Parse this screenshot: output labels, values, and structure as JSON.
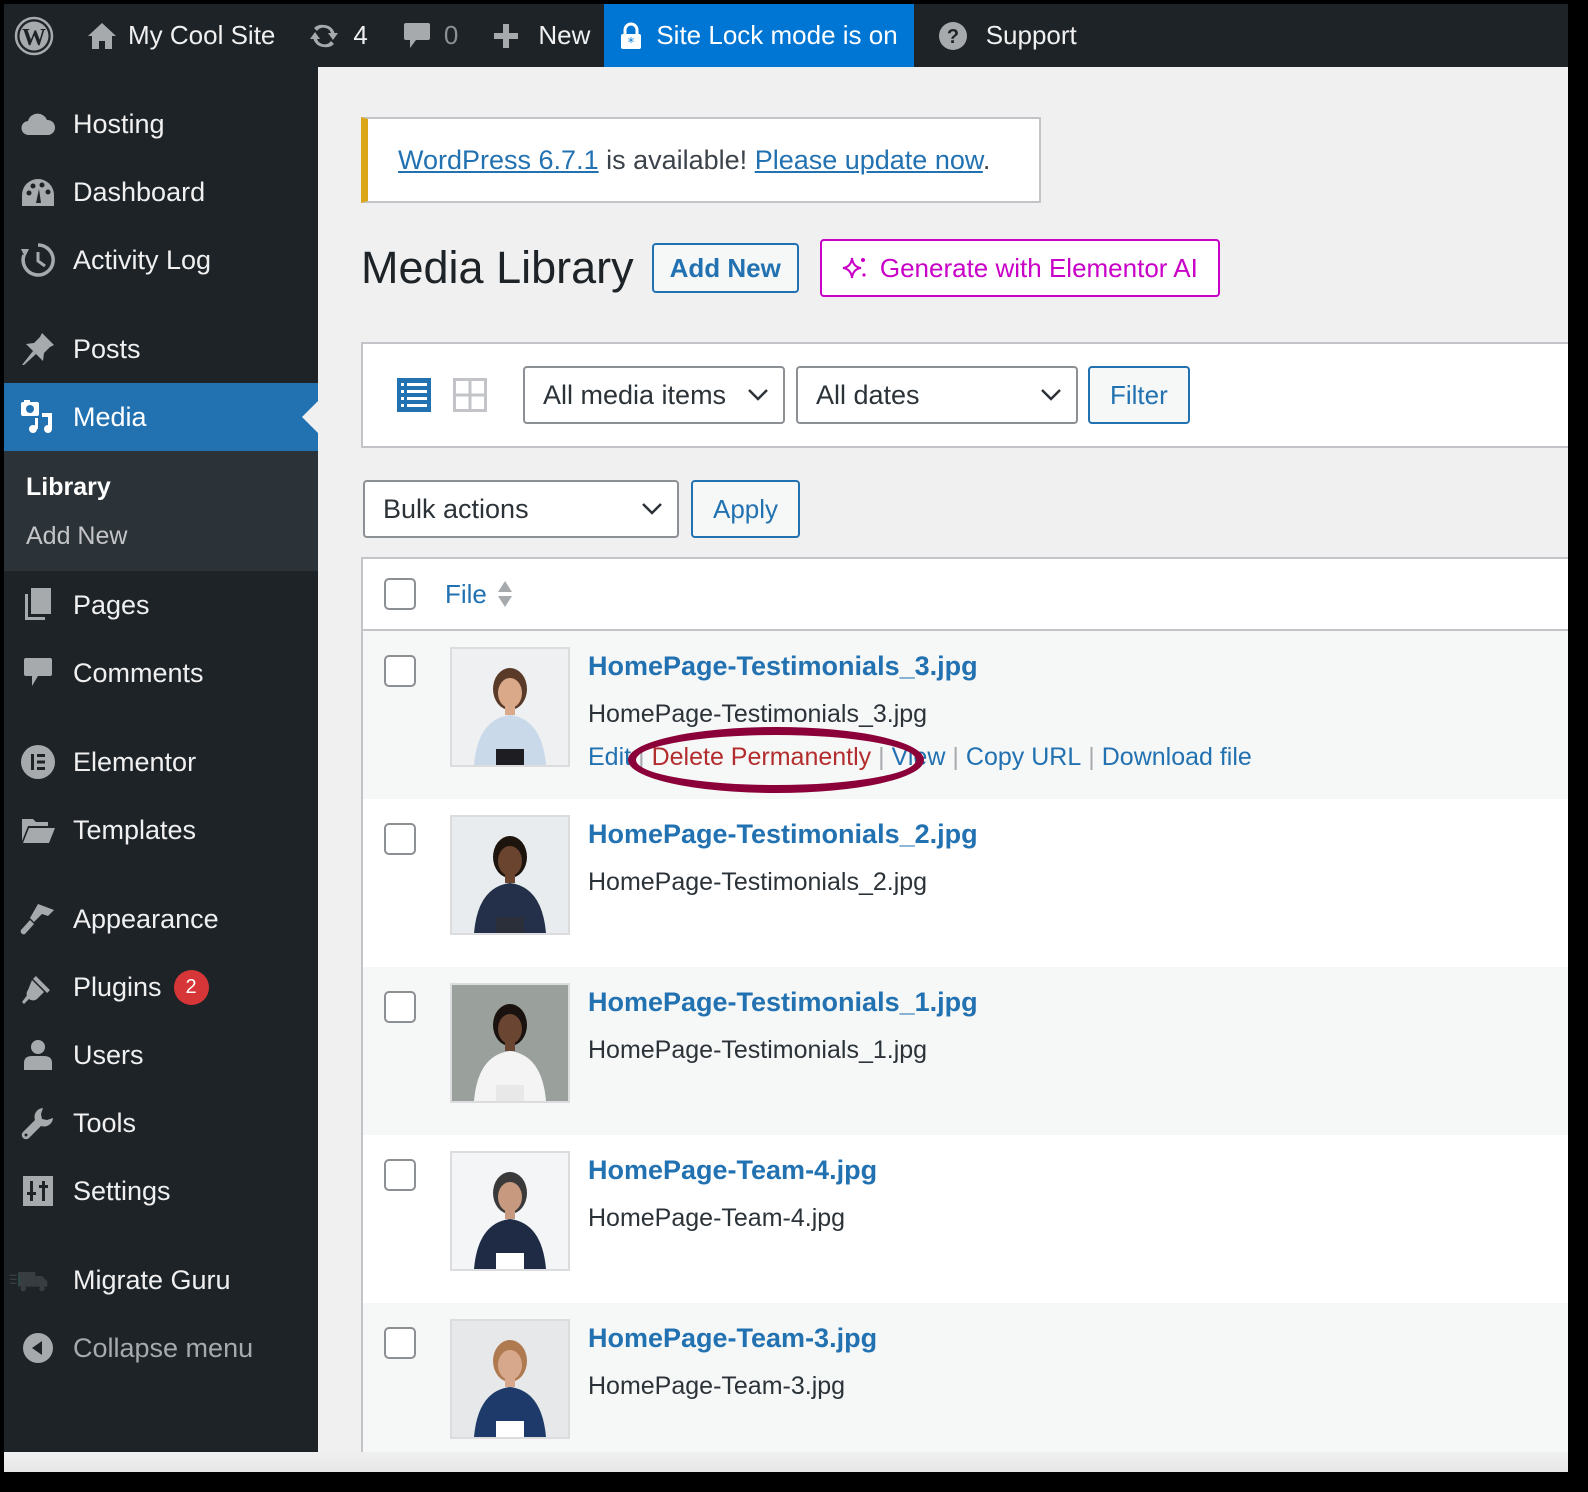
{
  "admin_bar": {
    "wp_logo": "wordpress-logo-icon",
    "site_name": "My Cool Site",
    "updates_count": "4",
    "comments_count": "0",
    "new_label": "New",
    "site_lock_label": "Site Lock mode is on",
    "support_label": "Support",
    "site_lock_color": "#0076d4"
  },
  "sidebar": {
    "items": [
      {
        "label": "Hosting",
        "icon": "cloud-icon"
      },
      {
        "label": "Dashboard",
        "icon": "dashboard-icon"
      },
      {
        "label": "Activity Log",
        "icon": "history-icon"
      },
      {
        "label": "Posts",
        "icon": "pin-icon"
      },
      {
        "label": "Media",
        "icon": "media-icon",
        "active": true
      },
      {
        "label": "Pages",
        "icon": "pages-icon"
      },
      {
        "label": "Comments",
        "icon": "comment-icon"
      },
      {
        "label": "Elementor",
        "icon": "elementor-icon"
      },
      {
        "label": "Templates",
        "icon": "folder-icon"
      },
      {
        "label": "Appearance",
        "icon": "paintbrush-icon"
      },
      {
        "label": "Plugins",
        "icon": "plugin-icon",
        "badge": "2"
      },
      {
        "label": "Users",
        "icon": "user-icon"
      },
      {
        "label": "Tools",
        "icon": "wrench-icon"
      },
      {
        "label": "Settings",
        "icon": "settings-icon"
      },
      {
        "label": "Migrate Guru",
        "icon": "truck-icon"
      },
      {
        "label": "Collapse menu",
        "icon": "collapse-icon"
      }
    ],
    "submenu": [
      {
        "label": "Library",
        "current": true
      },
      {
        "label": "Add New"
      }
    ],
    "active_color": "#2271b1"
  },
  "notice": {
    "link1": "WordPress 6.7.1",
    "text": " is available! ",
    "link2": "Please update now",
    "suffix": "."
  },
  "page": {
    "title": "Media Library",
    "add_new_label": "Add New",
    "ai_label": "Generate with Elementor AI",
    "ai_color": "#c800c8"
  },
  "filters": {
    "view_list": "list-view-icon",
    "view_grid": "grid-view-icon",
    "media_type_selected": "All media items",
    "date_selected": "All dates",
    "filter_label": "Filter"
  },
  "bulk": {
    "selected": "Bulk actions",
    "apply_label": "Apply"
  },
  "table": {
    "column_file": "File",
    "rows": [
      {
        "title": "HomePage-Testimonials_3.jpg",
        "filename": "HomePage-Testimonials_3.jpg",
        "show_actions": true
      },
      {
        "title": "HomePage-Testimonials_2.jpg",
        "filename": "HomePage-Testimonials_2.jpg"
      },
      {
        "title": "HomePage-Testimonials_1.jpg",
        "filename": "HomePage-Testimonials_1.jpg"
      },
      {
        "title": "HomePage-Team-4.jpg",
        "filename": "HomePage-Team-4.jpg"
      },
      {
        "title": "HomePage-Team-3.jpg",
        "filename": "HomePage-Team-3.jpg"
      }
    ],
    "row_actions": {
      "edit": "Edit",
      "delete": "Delete Permanently",
      "view": "View",
      "copy_url": "Copy URL",
      "download": "Download file",
      "separator": "|"
    },
    "delete_color": "#b32d2e",
    "highlight_color": "#8b0038"
  }
}
